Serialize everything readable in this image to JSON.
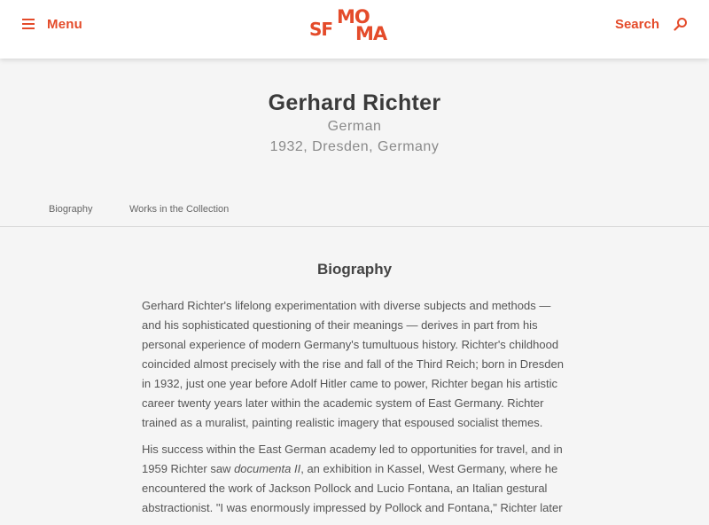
{
  "header": {
    "menu_label": "Menu",
    "logo": {
      "line1_left": "SF",
      "line1_right": "MO",
      "line2": "MA"
    },
    "search_label": "Search",
    "accent_color": "#e44b2a"
  },
  "artist": {
    "name": "Gerhard Richter",
    "nationality": "German",
    "birth": "1932, Dresden, Germany"
  },
  "tabs": [
    {
      "label": "Biography"
    },
    {
      "label": "Works in the Collection"
    }
  ],
  "biography": {
    "title": "Biography",
    "p1": "Gerhard Richter's lifelong experimentation with diverse subjects and methods — and his sophisticated questioning of their meanings — derives in part from his personal experience of modern Germany's tumultuous history. Richter's childhood coincided almost precisely with the rise and fall of the Third Reich; born in Dresden in 1932, just one year before Adolf Hitler came to power, Richter began his artistic career twenty years later within the academic system of East Germany. Richter trained as a muralist, painting realistic imagery that espoused socialist themes.",
    "p2_before": "His success within the East German academy led to opportunities for travel, and in 1959 Richter saw ",
    "p2_italic": "documenta II",
    "p2_after": ", an exhibition in Kassel, West Germany, where he encountered the work of Jackson Pollock and Lucio Fontana, an Italian gestural abstractionist. \"I was enormously impressed by Pollock and Fontana,\" Richter later"
  }
}
